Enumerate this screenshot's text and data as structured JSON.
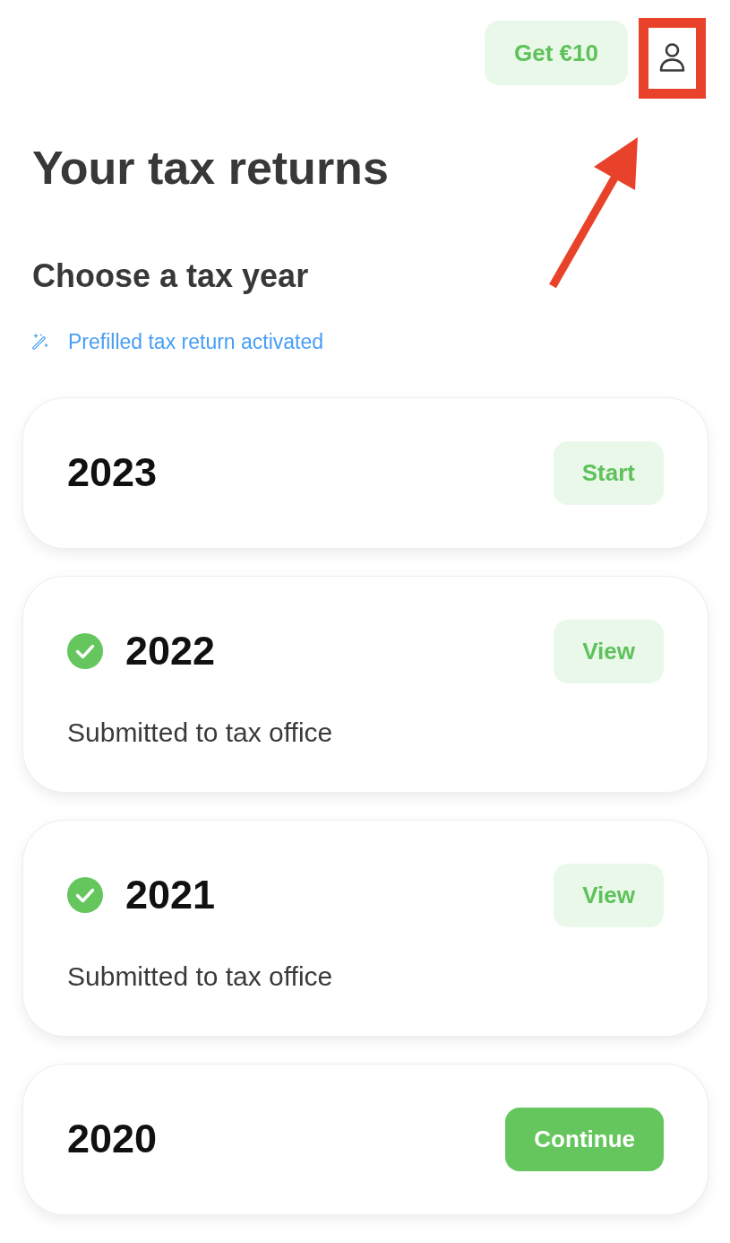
{
  "header": {
    "referral_button": {
      "label": "Get €10"
    },
    "profile_button": {
      "highlighted": true
    }
  },
  "title": "Your tax returns",
  "section_title": "Choose a tax year",
  "prefill_notice": {
    "text": "Prefilled tax return activated"
  },
  "tax_years": [
    {
      "year": "2023",
      "completed": false,
      "action": {
        "label": "Start",
        "kind": "secondary"
      }
    },
    {
      "year": "2022",
      "completed": true,
      "status": "Submitted to tax office",
      "action": {
        "label": "View",
        "kind": "secondary"
      }
    },
    {
      "year": "2021",
      "completed": true,
      "status": "Submitted to tax office",
      "action": {
        "label": "View",
        "kind": "secondary"
      }
    },
    {
      "year": "2020",
      "completed": false,
      "action": {
        "label": "Continue",
        "kind": "primary"
      }
    }
  ]
}
